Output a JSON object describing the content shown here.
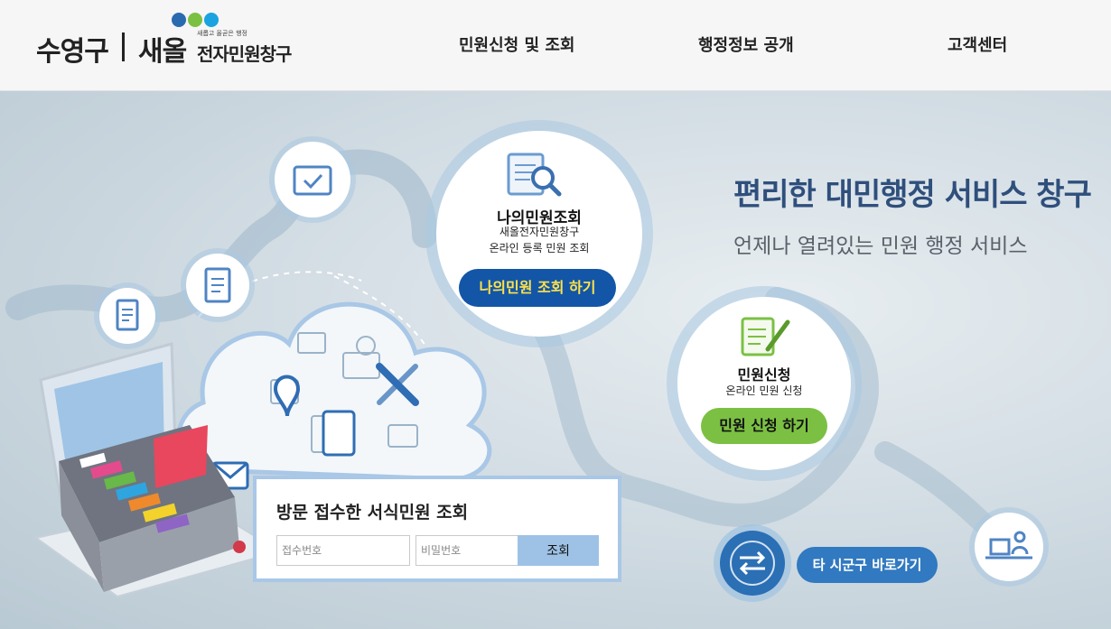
{
  "header": {
    "district": "수영구",
    "brand": "새올",
    "tagline": "새롭고 올곧은 행정",
    "service_name": "전자민원창구",
    "dot_colors": [
      "#2a6bb0",
      "#7cc043",
      "#1aa3e0"
    ],
    "nav": [
      "민원신청 및 조회",
      "행정정보 공개",
      "고객센터"
    ]
  },
  "hero": {
    "headline": "편리한 대민행정 서비스 창구",
    "subline": "언제나 열려있는 민원 행정 서비스"
  },
  "my_inquiry": {
    "title": "나의민원조회",
    "desc1": "새올전자민원창구",
    "desc2": "온라인 등록 민원 조회",
    "button": "나의민원 조회 하기"
  },
  "application": {
    "title": "민원신청",
    "desc": "온라인 민원 신청",
    "button": "민원 신청 하기"
  },
  "visit_query": {
    "title": "방문 접수한 서식민원 조회",
    "receipt_placeholder": "접수번호",
    "password_placeholder": "비밀번호",
    "button": "조회"
  },
  "goto": {
    "button": "타 시군구 바로가기"
  },
  "colors": {
    "primary_blue": "#1356a7",
    "button_yellow_text": "#ffe24a",
    "green": "#7bc043",
    "headline": "#2f4f7c"
  },
  "icons": [
    "folder-check-icon",
    "clipboard-icon",
    "document-icon",
    "search-document-icon",
    "certificate-pen-icon",
    "location-pin-icon",
    "usb-icon",
    "mail-icon",
    "arrows-icon",
    "desk-person-icon",
    "filing-cabinet-illustration"
  ]
}
